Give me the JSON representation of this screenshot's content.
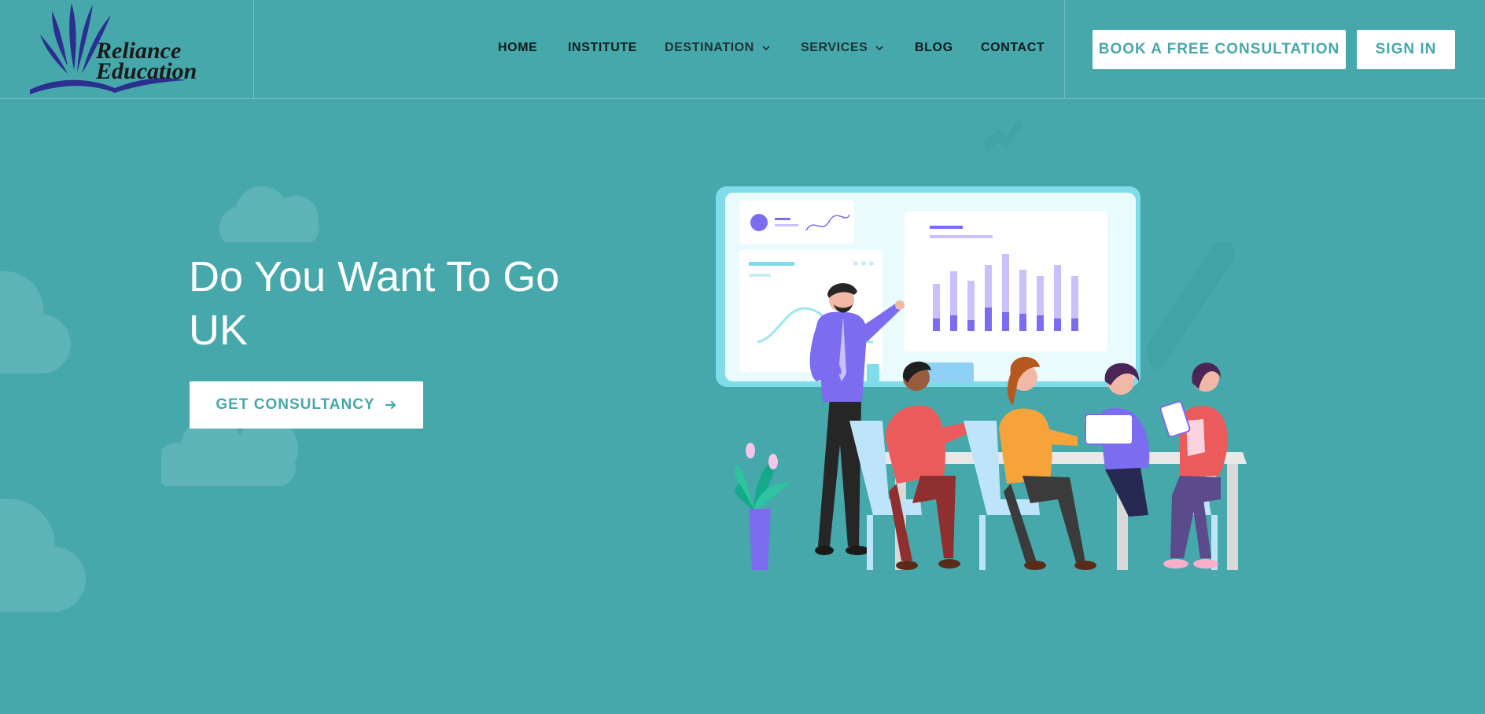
{
  "brand": {
    "line1": "Reliance",
    "line2": "Education"
  },
  "nav": {
    "items": [
      {
        "label": "HOME",
        "has_dropdown": false
      },
      {
        "label": "INSTITUTE",
        "has_dropdown": false
      },
      {
        "label": "DESTINATION",
        "has_dropdown": true
      },
      {
        "label": "SERVICES",
        "has_dropdown": true
      },
      {
        "label": "BLOG",
        "has_dropdown": false
      },
      {
        "label": "CONTACT",
        "has_dropdown": false
      }
    ]
  },
  "header_buttons": {
    "consultation": "BOOK A FREE CONSULTATION",
    "sign_in": "SIGN IN"
  },
  "hero": {
    "title_line1": "Do You Want To Go",
    "title_line2": "UK",
    "cta_label": "GET CONSULTANCY",
    "cta_icon": "arrow-right-icon"
  },
  "colors": {
    "background": "#46a8aa",
    "button_bg": "#ffffff",
    "button_text": "#46a8aa",
    "logo_blue": "#2b2f8f"
  }
}
